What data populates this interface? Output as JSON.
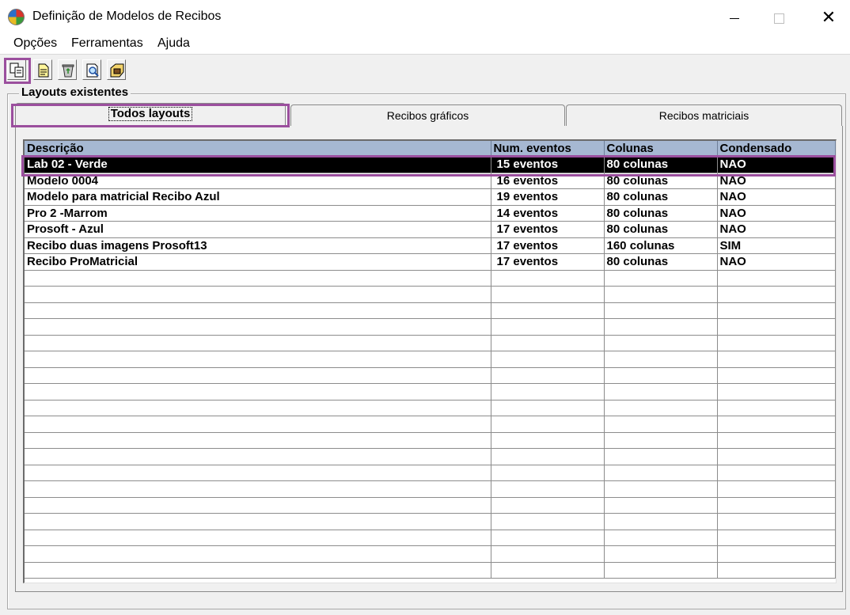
{
  "window": {
    "title": "Definição de Modelos de Recibos",
    "controls": {
      "minimize": "—",
      "maximize": "☐",
      "close": "✕"
    }
  },
  "menu": [
    "Opções",
    "Ferramentas",
    "Ajuda"
  ],
  "toolbar": {
    "buttons": [
      "copy-layout-icon",
      "new-document-icon",
      "recycle-bin-icon",
      "preview-icon",
      "edit-tag-icon"
    ]
  },
  "group": {
    "label": "Layouts existentes"
  },
  "tabs": [
    {
      "label": "Todos layouts",
      "active": true
    },
    {
      "label": "Recibos gráficos",
      "active": false
    },
    {
      "label": "Recibos matriciais",
      "active": false
    }
  ],
  "table": {
    "headers": [
      "Descrição",
      "Num. eventos",
      "Colunas",
      "Condensado"
    ],
    "rows": [
      [
        "Lab 02 - Verde",
        "15 eventos",
        "80 colunas",
        "NAO"
      ],
      [
        "Modelo 0004",
        "16 eventos",
        "80 colunas",
        "NAO"
      ],
      [
        "Modelo para matricial Recibo Azul",
        "19 eventos",
        "80 colunas",
        "NAO"
      ],
      [
        "Pro 2 -Marrom",
        "14 eventos",
        "80 colunas",
        "NAO"
      ],
      [
        "Prosoft - Azul",
        "17 eventos",
        "80 colunas",
        "NAO"
      ],
      [
        "Recibo duas imagens Prosoft13",
        "17 eventos",
        "160 colunas",
        "SIM"
      ],
      [
        "Recibo ProMatricial",
        "17 eventos",
        "80 colunas",
        "NAO"
      ]
    ],
    "selected_row": 0,
    "empty_rows": 19
  },
  "colors": {
    "header_bg": "#a6b8d2",
    "selection_bg": "#000000",
    "highlight_border": "#9b4f9e"
  }
}
